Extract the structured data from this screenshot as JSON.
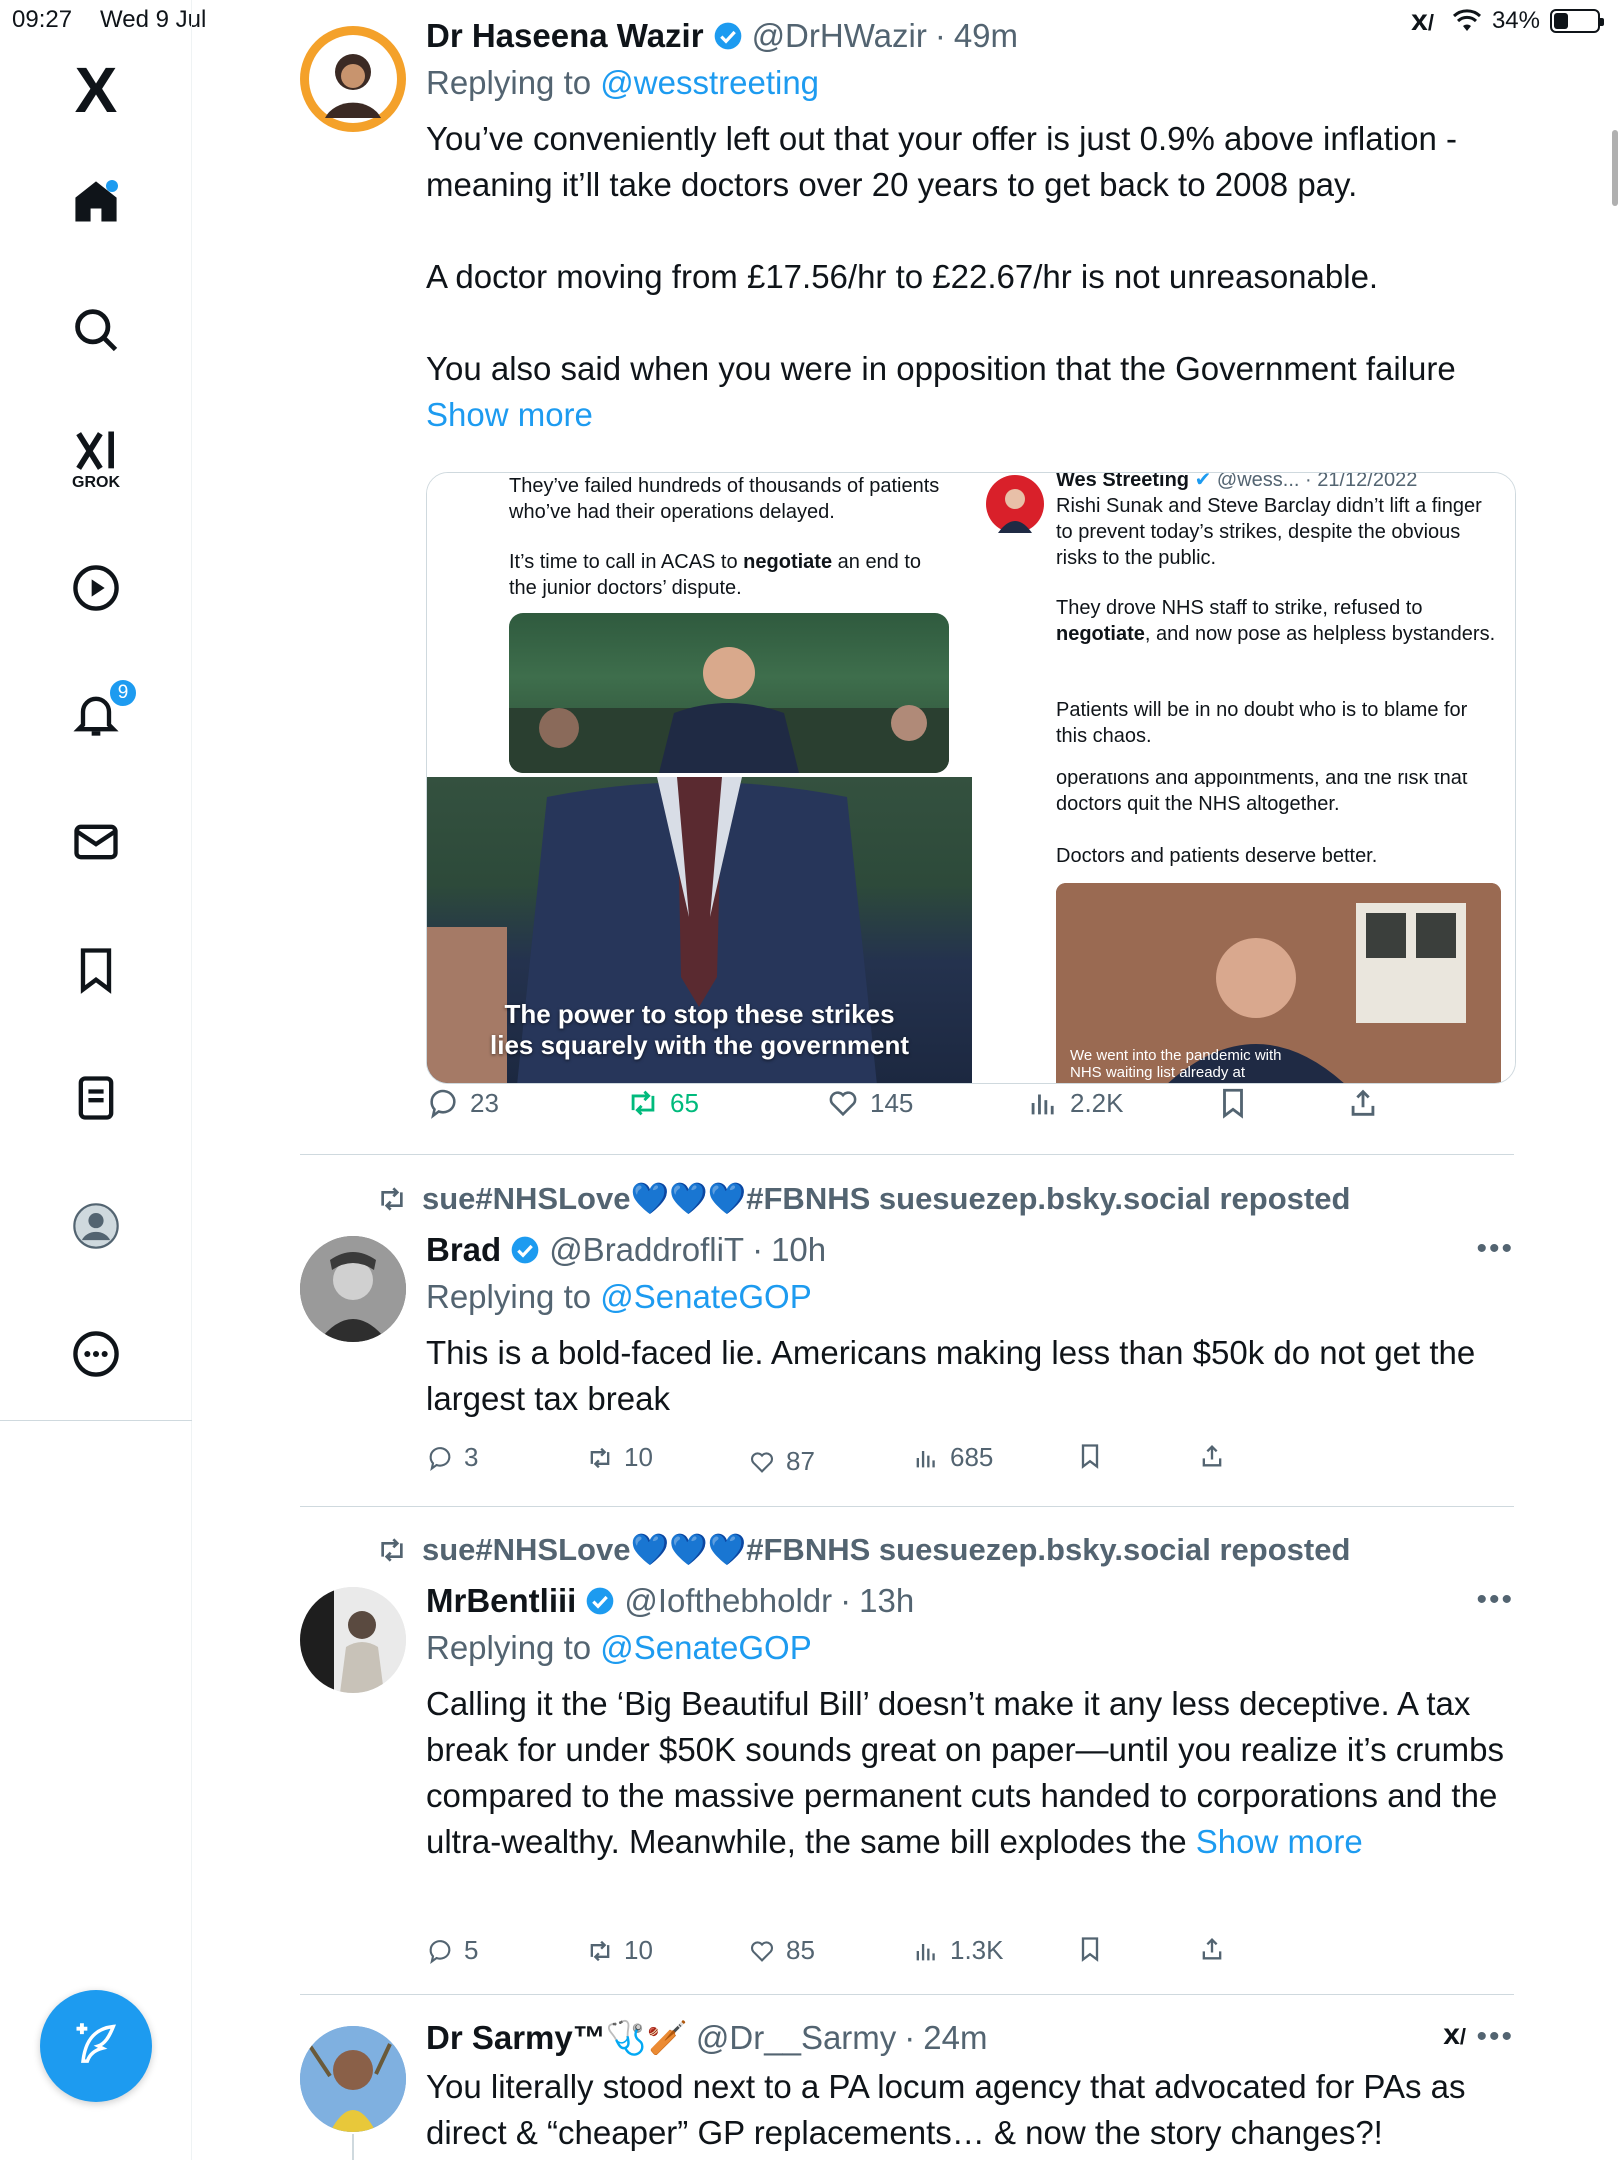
{
  "status_bar": {
    "time": "09:27",
    "date": "Wed 9 Jul",
    "battery": "34%",
    "battery_level": 0.34
  },
  "sidebar": {
    "logo": "X",
    "grok_label": "GROK",
    "notification_count": "9",
    "items": [
      "home-icon",
      "search-icon",
      "grok-icon",
      "video-icon",
      "bell-icon",
      "mail-icon",
      "bookmark-icon",
      "list-icon",
      "profile-icon",
      "more-icon"
    ]
  },
  "posts": [
    {
      "name": "Dr Haseena Wazir",
      "handle": "@DrHWazir",
      "time": "49m",
      "replying_to": "Replying to",
      "replying_handle": "@wesstreeting",
      "paragraphs": [
        "You’ve conveniently left out that your offer is just 0.9% above inflation - meaning it’ll take doctors over 20 years to get back to 2008 pay.",
        "A doctor moving from £17.56/hr to £22.67/hr is not unreasonable."
      ],
      "last_paragraph": "You also said when you were in opposition that the Government failure",
      "show_more": "Show more",
      "media": {
        "left_text_1": "They’ve failed hundreds of thousands of patients who’ve had their operations delayed.",
        "left_text_2a": "It’s time to call in ACAS to ",
        "left_text_2b": "negotiate",
        "left_text_2c": " an end to the junior doctors’ dispute.",
        "caption_line_1": "The power to stop these strikes",
        "caption_line_2": "lies squarely with the government",
        "quoted_name": "Wes Streeting",
        "quoted_handle": "@wess...",
        "quoted_date": "· 21/12/2022",
        "quoted_p1": "Rishi Sunak and Steve Barclay didn’t lift a finger to prevent today’s strikes, despite the obvious risks to the public.",
        "quoted_p2a": "They drove NHS staff to strike, refused to ",
        "quoted_p2b": "negotiate",
        "quoted_p2c": ", and now pose as helpless bystanders.",
        "quoted_p3": "Patients will be in no doubt who is to blame for this chaos.",
        "quoted_cut": "operations and appointments, and the risk that",
        "quoted_p4": "doctors quit the NHS altogether.",
        "quoted_p5": "Doctors and patients deserve better.",
        "news_caption_1": "We went into the pandemic with",
        "news_caption_2": "NHS waiting list already at"
      },
      "stats": {
        "replies": "23",
        "reposts": "65",
        "likes": "145",
        "views": "2.2K"
      }
    },
    {
      "repost_by": "sue#NHSLove💙💙💙#FBNHS suesuezep.bsky.social reposted",
      "name": "Brad",
      "handle": "@BraddrofliT",
      "time": "10h",
      "replying_to": "Replying to",
      "replying_handle": "@SenateGOP",
      "text": "This is a bold-faced lie. Americans making less than $50k do not get the largest tax break",
      "stats": {
        "replies": "3",
        "reposts": "10",
        "likes": "87",
        "views": "685"
      }
    },
    {
      "repost_by": "sue#NHSLove💙💙💙#FBNHS suesuezep.bsky.social reposted",
      "name": "MrBentliii",
      "handle": "@Iofthebholdr",
      "time": "13h",
      "replying_to": "Replying to",
      "replying_handle": "@SenateGOP",
      "text": "Calling it the ‘Big Beautiful Bill’ doesn’t make it any less deceptive. A tax break for under $50K sounds great on paper—until you realize it’s crumbs compared to the massive permanent cuts handed to corporations and the ultra-wealthy. Meanwhile, the same bill explodes the",
      "show_more": "Show more",
      "stats": {
        "replies": "5",
        "reposts": "10",
        "likes": "85",
        "views": "1.3K"
      }
    },
    {
      "name": "Dr Sarmy™🩺🏏",
      "handle": "@Dr__Sarmy",
      "time": "24m",
      "text": "You literally stood next to a PA locum agency that advocated for PAs as direct & “cheaper” GP replacements… & now the story changes?!"
    }
  ],
  "colors": {
    "accent": "#1d9bf0",
    "repost_active": "#00ba7c",
    "muted": "#536471"
  }
}
